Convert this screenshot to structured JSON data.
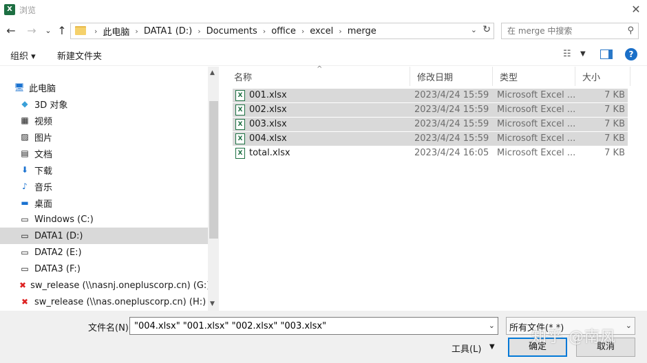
{
  "window": {
    "title": "浏览",
    "app_icon": "X"
  },
  "nav": {
    "back": "←",
    "forward": "→",
    "recent": "⌄",
    "up": "↑"
  },
  "address": {
    "crumbs": [
      "此电脑",
      "DATA1 (D:)",
      "Documents",
      "office",
      "excel",
      "merge"
    ]
  },
  "search": {
    "placeholder": "在 merge 中搜索"
  },
  "toolbar": {
    "organize": "组织 ▾",
    "new_folder": "新建文件夹"
  },
  "sidebar": {
    "items": [
      {
        "label": "此电脑",
        "icon": "computer-icon",
        "glyph": "🖥"
      },
      {
        "label": "3D 对象",
        "icon": "cube-icon",
        "glyph": "◆"
      },
      {
        "label": "视频",
        "icon": "video-icon",
        "glyph": "▦"
      },
      {
        "label": "图片",
        "icon": "picture-icon",
        "glyph": "▨"
      },
      {
        "label": "文档",
        "icon": "document-icon",
        "glyph": "▤"
      },
      {
        "label": "下载",
        "icon": "download-icon",
        "glyph": "⬇"
      },
      {
        "label": "音乐",
        "icon": "music-icon",
        "glyph": "♪"
      },
      {
        "label": "桌面",
        "icon": "desktop-icon",
        "glyph": "▬"
      },
      {
        "label": "Windows (C:)",
        "icon": "drive-icon",
        "glyph": "▭"
      },
      {
        "label": "DATA1 (D:)",
        "icon": "drive-icon",
        "glyph": "▭",
        "selected": true
      },
      {
        "label": "DATA2 (E:)",
        "icon": "drive-icon",
        "glyph": "▭"
      },
      {
        "label": "DATA3 (F:)",
        "icon": "drive-icon",
        "glyph": "▭"
      },
      {
        "label": "sw_release (\\\\nasnj.onepluscorp.cn) (G:)",
        "icon": "network-drive-icon",
        "glyph": "✖"
      },
      {
        "label": "sw_release (\\\\nas.onepluscorp.cn) (H:)",
        "icon": "network-drive-icon",
        "glyph": "✖"
      }
    ]
  },
  "columns": {
    "name": "名称",
    "modified": "修改日期",
    "type": "类型",
    "size": "大小"
  },
  "files": [
    {
      "name": "001.xlsx",
      "modified": "2023/4/24 15:59",
      "type": "Microsoft Excel ...",
      "size": "7 KB",
      "selected": true
    },
    {
      "name": "002.xlsx",
      "modified": "2023/4/24 15:59",
      "type": "Microsoft Excel ...",
      "size": "7 KB",
      "selected": true
    },
    {
      "name": "003.xlsx",
      "modified": "2023/4/24 15:59",
      "type": "Microsoft Excel ...",
      "size": "7 KB",
      "selected": true
    },
    {
      "name": "004.xlsx",
      "modified": "2023/4/24 15:59",
      "type": "Microsoft Excel ...",
      "size": "7 KB",
      "selected": true
    },
    {
      "name": "total.xlsx",
      "modified": "2023/4/24 16:05",
      "type": "Microsoft Excel ...",
      "size": "7 KB",
      "selected": false
    }
  ],
  "footer": {
    "filename_label": "文件名(N):",
    "filename_value": "\"004.xlsx\" \"001.xlsx\" \"002.xlsx\" \"003.xlsx\"",
    "filetype_value": "所有文件(*.*)",
    "tools_label": "工具(L)",
    "open_label": "确定",
    "cancel_label": "取消"
  },
  "watermark": "知乎 @南风",
  "colors": {
    "selection": "#d9d9d9",
    "excel_green": "#1d6f42",
    "accent": "#0078d7"
  }
}
